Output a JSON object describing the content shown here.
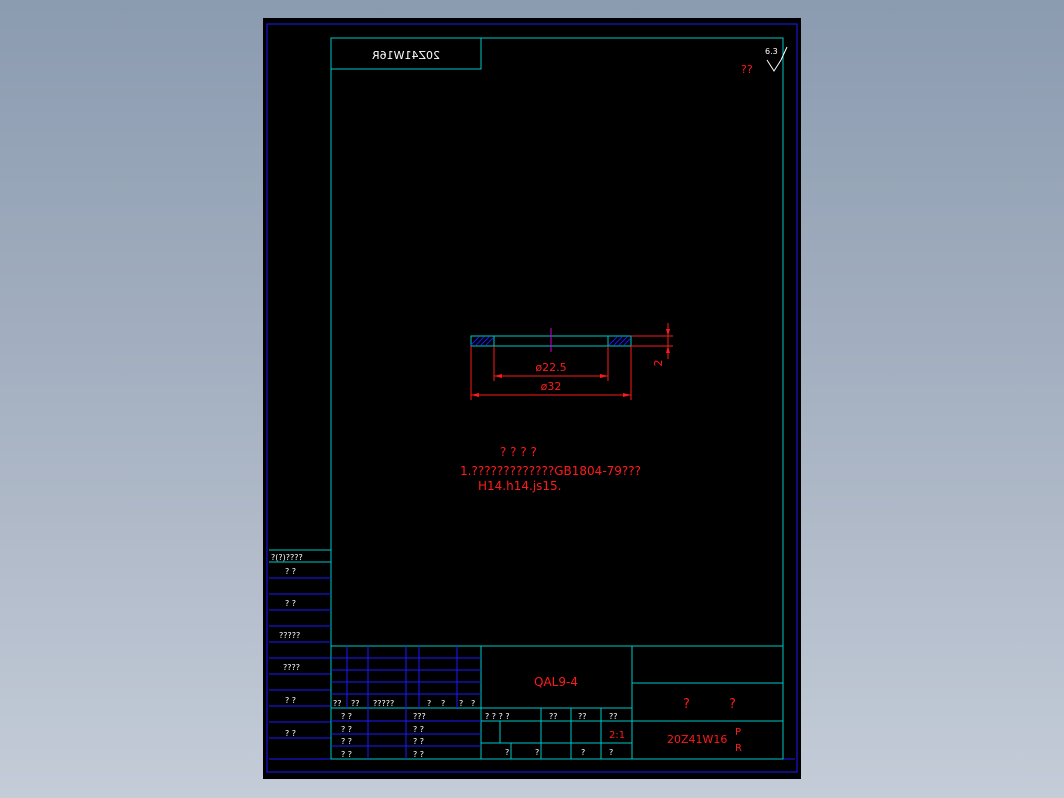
{
  "drawing": {
    "code_mirrored": "20Z41W16R",
    "roughness_value": "6.3",
    "roughness_label": "??",
    "dim_inner_diameter": "ø22.5",
    "dim_outer_diameter": "ø32",
    "dim_thickness": "2",
    "notes_title": "? ? ? ?",
    "notes_line1": "1.?????????????GB1804-79???",
    "notes_line2": "H14.h14.js15."
  },
  "side_table": {
    "rows": [
      "?(?)????",
      "?   ?",
      "?   ?",
      "?????",
      "????",
      "?   ?",
      "?   ?"
    ]
  },
  "title_block": {
    "material": "QAL9-4",
    "title_left": "?",
    "title_right": "?",
    "drawing_no": "20Z41W16",
    "drawing_no_suffix_top": "P",
    "drawing_no_suffix_bottom": "R",
    "scale": "2:1",
    "sign_header": [
      "??",
      "??",
      "?????",
      "?",
      "?",
      "?",
      "?"
    ],
    "sign_rows": [
      [
        "? ?",
        "???"
      ],
      [
        "? ?",
        "? ?"
      ],
      [
        "? ?",
        "? ?"
      ],
      [
        "? ?",
        "? ?"
      ]
    ],
    "mid_header": [
      "? ? ? ?",
      "??",
      "??",
      "??"
    ],
    "mid_footer": [
      "?",
      "?",
      "?",
      "?"
    ]
  },
  "colors": {
    "frame_outer": "#1a1aff",
    "frame_inner": "#00c8c8",
    "dimension": "#ff1a1a",
    "center_mark": "#d000d0",
    "text": "#ffffff"
  }
}
